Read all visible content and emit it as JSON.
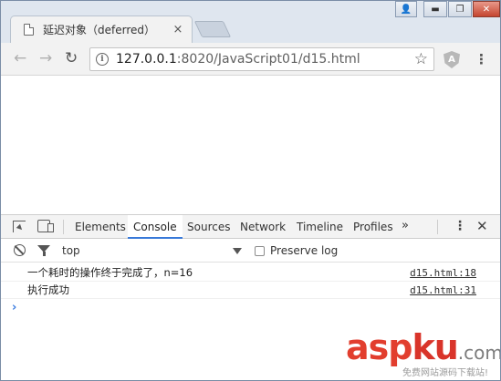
{
  "tab": {
    "title": "延迟对象（deferred）",
    "close": "×"
  },
  "window_controls": {
    "user": "👤",
    "minimize": "▬",
    "maximize": "❐",
    "close": "✕"
  },
  "toolbar": {
    "back": "←",
    "forward": "→",
    "reload": "↻",
    "url_host": "127.0.0.1",
    "url_rest": ":8020/JavaScript01/d15.html",
    "info": "i",
    "star": "☆",
    "extension": "A",
    "menu": "⋮"
  },
  "devtools": {
    "tabs": [
      "Elements",
      "Console",
      "Sources",
      "Network",
      "Timeline",
      "Profiles"
    ],
    "active_tab": "Console",
    "more": "»",
    "menu": "⋮",
    "close": "✕",
    "context": "top",
    "preserve_log_label": "Preserve log",
    "messages": [
      {
        "text": "一个耗时的操作终于完成了，n=16",
        "source": "d15.html:18"
      },
      {
        "text": "执行成功",
        "source": "d15.html:31"
      }
    ],
    "prompt": "›"
  },
  "watermark": {
    "main": "asp",
    "ku": "ku",
    "com": ".com",
    "sub": "免费网站源码下载站!"
  }
}
